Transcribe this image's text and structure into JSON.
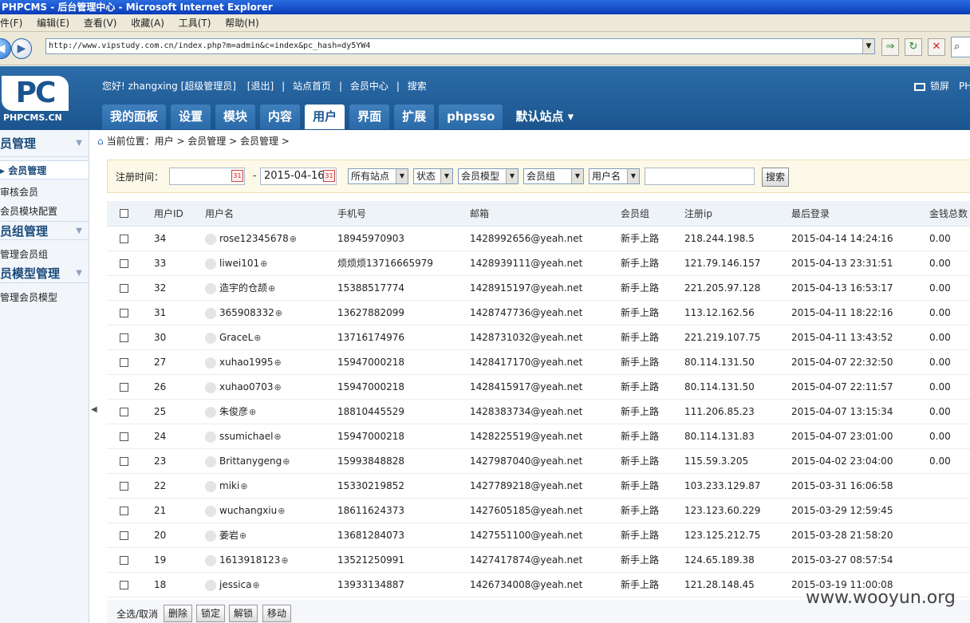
{
  "window": {
    "title": "PHPCMS - 后台管理中心 - Microsoft Internet Explorer"
  },
  "ie_menu": [
    "件(F)",
    "编辑(E)",
    "查看(V)",
    "收藏(A)",
    "工具(T)",
    "帮助(H)"
  ],
  "address": {
    "url": "http://www.vipstudy.com.cn/index.php?m=admin&c=index&pc_hash=dy5YW4"
  },
  "header": {
    "logo_mark": "PC",
    "logo_text": "PHPCMS.CN",
    "greeting": "您好! zhangxing [超级管理员]",
    "logout": "[退出]",
    "site_home": "站点首页",
    "member_center": "会员中心",
    "search": "搜索",
    "lock_screen": "锁屏",
    "right_cut": "PH"
  },
  "tabs": [
    {
      "label": "我的面板"
    },
    {
      "label": "设置"
    },
    {
      "label": "模块"
    },
    {
      "label": "内容"
    },
    {
      "label": "用户",
      "active": true
    },
    {
      "label": "界面"
    },
    {
      "label": "扩展"
    },
    {
      "label": "phpsso"
    },
    {
      "label": "默认站点 ▾"
    }
  ],
  "sidebar": {
    "sections": [
      {
        "title": "员管理",
        "items": [
          "会员管理",
          "审核会员",
          "会员模块配置"
        ]
      },
      {
        "title": "员组管理",
        "items": [
          "管理会员组"
        ]
      },
      {
        "title": "员模型管理",
        "items": [
          "管理会员模型"
        ]
      }
    ]
  },
  "breadcrumb": "当前位置：用户 > 会员管理 > 会员管理 >",
  "filter": {
    "reg_time_label": "注册时间：",
    "date_from": "",
    "separator": "-",
    "date_to": "2015-04-16",
    "selects": [
      "所有站点",
      "状态",
      "会员模型",
      "会员组",
      "用户名"
    ],
    "keyword": "",
    "search_btn": "搜索"
  },
  "table": {
    "columns": [
      "用户ID",
      "用户名",
      "手机号",
      "邮箱",
      "会员组",
      "注册ip",
      "最后登录",
      "金钱总数"
    ],
    "rows": [
      {
        "id": "34",
        "name": "rose12345678",
        "phone": "18945970903",
        "email": "1428992656@yeah.net",
        "group": "新手上路",
        "ip": "218.244.198.5",
        "last": "2015-04-14 14:24:16",
        "money": "0.00"
      },
      {
        "id": "33",
        "name": "liwei101",
        "phone": "烦烦烦13716665979",
        "email": "1428939111@yeah.net",
        "group": "新手上路",
        "ip": "121.79.146.157",
        "last": "2015-04-13 23:31:51",
        "money": "0.00"
      },
      {
        "id": "32",
        "name": "造宇的仓颉",
        "phone": "15388517774",
        "email": "1428915197@yeah.net",
        "group": "新手上路",
        "ip": "221.205.97.128",
        "last": "2015-04-13 16:53:17",
        "money": "0.00"
      },
      {
        "id": "31",
        "name": "365908332",
        "phone": "13627882099",
        "email": "1428747736@yeah.net",
        "group": "新手上路",
        "ip": "113.12.162.56",
        "last": "2015-04-11 18:22:16",
        "money": "0.00"
      },
      {
        "id": "30",
        "name": "GraceL",
        "phone": "13716174976",
        "email": "1428731032@yeah.net",
        "group": "新手上路",
        "ip": "221.219.107.75",
        "last": "2015-04-11 13:43:52",
        "money": "0.00"
      },
      {
        "id": "27",
        "name": "xuhao1995",
        "phone": "15947000218",
        "email": "1428417170@yeah.net",
        "group": "新手上路",
        "ip": "80.114.131.50",
        "last": "2015-04-07 22:32:50",
        "money": "0.00"
      },
      {
        "id": "26",
        "name": "xuhao0703",
        "phone": "15947000218",
        "email": "1428415917@yeah.net",
        "group": "新手上路",
        "ip": "80.114.131.50",
        "last": "2015-04-07 22:11:57",
        "money": "0.00"
      },
      {
        "id": "25",
        "name": "朱俊彦",
        "phone": "18810445529",
        "email": "1428383734@yeah.net",
        "group": "新手上路",
        "ip": "111.206.85.23",
        "last": "2015-04-07 13:15:34",
        "money": "0.00"
      },
      {
        "id": "24",
        "name": "ssumichael",
        "phone": "15947000218",
        "email": "1428225519@yeah.net",
        "group": "新手上路",
        "ip": "80.114.131.83",
        "last": "2015-04-07 23:01:00",
        "money": "0.00"
      },
      {
        "id": "23",
        "name": "Brittanygeng",
        "phone": "15993848828",
        "email": "1427987040@yeah.net",
        "group": "新手上路",
        "ip": "115.59.3.205",
        "last": "2015-04-02 23:04:00",
        "money": "0.00"
      },
      {
        "id": "22",
        "name": "miki",
        "phone": "15330219852",
        "email": "1427789218@yeah.net",
        "group": "新手上路",
        "ip": "103.233.129.87",
        "last": "2015-03-31 16:06:58",
        "money": ""
      },
      {
        "id": "21",
        "name": "wuchangxiu",
        "phone": "18611624373",
        "email": "1427605185@yeah.net",
        "group": "新手上路",
        "ip": "123.123.60.229",
        "last": "2015-03-29 12:59:45",
        "money": ""
      },
      {
        "id": "20",
        "name": "姜岩",
        "phone": "13681284073",
        "email": "1427551100@yeah.net",
        "group": "新手上路",
        "ip": "123.125.212.75",
        "last": "2015-03-28 21:58:20",
        "money": ""
      },
      {
        "id": "19",
        "name": "1613918123",
        "phone": "13521250991",
        "email": "1427417874@yeah.net",
        "group": "新手上路",
        "ip": "124.65.189.38",
        "last": "2015-03-27 08:57:54",
        "money": ""
      },
      {
        "id": "18",
        "name": "jessica",
        "phone": "13933134887",
        "email": "1426734008@yeah.net",
        "group": "新手上路",
        "ip": "121.28.148.45",
        "last": "2015-03-19 11:00:08",
        "money": ""
      }
    ]
  },
  "bottom_bar": {
    "select_all": "全选/取消",
    "buttons": [
      "删除",
      "锁定",
      "解锁",
      "移动"
    ]
  },
  "watermark": "www.wooyun.org"
}
